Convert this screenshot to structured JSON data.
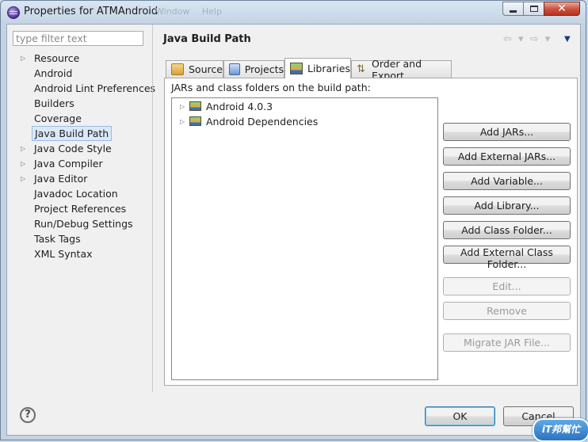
{
  "window": {
    "title": "Properties for ATMAndroid",
    "background_hint": "Window   Help",
    "controls": {
      "minimize": "minimize",
      "maximize": "maximize",
      "close": "close"
    }
  },
  "filter": {
    "placeholder": "type filter text",
    "value": ""
  },
  "sidebar": {
    "items": [
      {
        "label": "Resource",
        "expandable": true
      },
      {
        "label": "Android",
        "expandable": false
      },
      {
        "label": "Android Lint Preferences",
        "expandable": false
      },
      {
        "label": "Builders",
        "expandable": false
      },
      {
        "label": "Coverage",
        "expandable": false
      },
      {
        "label": "Java Build Path",
        "expandable": false,
        "selected": true
      },
      {
        "label": "Java Code Style",
        "expandable": true
      },
      {
        "label": "Java Compiler",
        "expandable": true
      },
      {
        "label": "Java Editor",
        "expandable": true
      },
      {
        "label": "Javadoc Location",
        "expandable": false
      },
      {
        "label": "Project References",
        "expandable": false
      },
      {
        "label": "Run/Debug Settings",
        "expandable": false
      },
      {
        "label": "Task Tags",
        "expandable": true
      },
      {
        "label": "XML Syntax",
        "expandable": true
      }
    ]
  },
  "page": {
    "title": "Java Build Path",
    "nav": {
      "back": "⇦",
      "forward": "⇨",
      "dropdown": "▾",
      "menu": "▼"
    }
  },
  "tabs": [
    {
      "label": "Source",
      "icon": "source-folder-icon"
    },
    {
      "label": "Projects",
      "icon": "projects-icon"
    },
    {
      "label": "Libraries",
      "icon": "libraries-icon",
      "active": true
    },
    {
      "label": "Order and Export",
      "icon": "order-export-icon"
    }
  ],
  "libraries": {
    "caption": "JARs and class folders on the build path:",
    "entries": [
      {
        "label": "Android 4.0.3"
      },
      {
        "label": "Android Dependencies"
      }
    ],
    "buttons": {
      "add_jars": "Add JARs...",
      "add_external_jars": "Add External JARs...",
      "add_variable": "Add Variable...",
      "add_library": "Add Library...",
      "add_class_folder": "Add Class Folder...",
      "add_external_class_folder": "Add External Class Folder...",
      "edit": "Edit...",
      "remove": "Remove",
      "migrate_jar": "Migrate JAR File..."
    }
  },
  "dialog": {
    "help": "?",
    "ok": "OK",
    "cancel": "Cancel"
  },
  "watermark": {
    "text": "iT邦幫忙"
  },
  "colors": {
    "selection": "#dae8fa",
    "titlebar": "#c3d3e4",
    "close_button": "#c9503b"
  }
}
